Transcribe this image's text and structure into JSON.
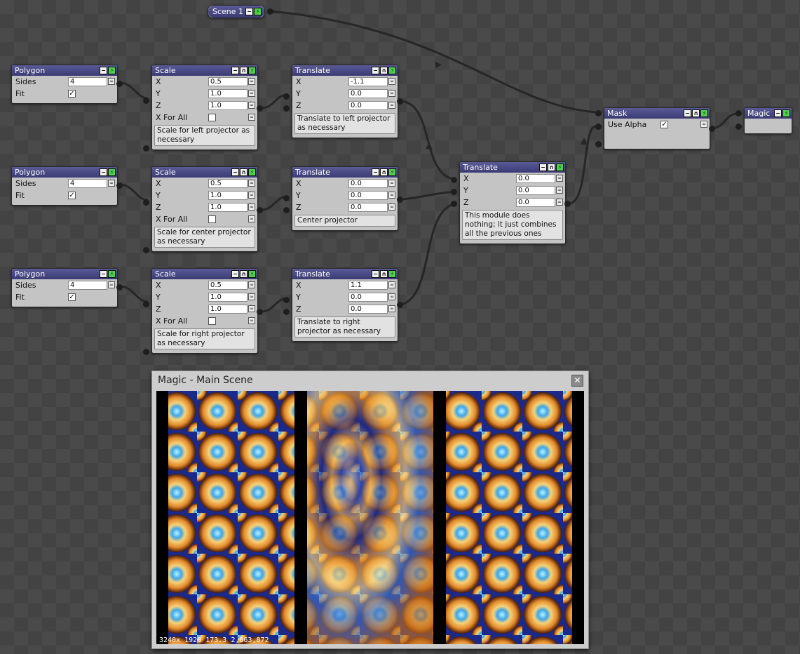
{
  "scene": {
    "title": "Scene 1"
  },
  "rows": [
    {
      "polygon": {
        "title": "Polygon",
        "sides_label": "Sides",
        "sides": "4",
        "fit_label": "Fit",
        "fit": "✓"
      },
      "scale": {
        "title": "Scale",
        "x_label": "X",
        "x": "0.5",
        "y_label": "Y",
        "y": "1.0",
        "z_label": "Z",
        "z": "1.0",
        "xforall_label": "X For All",
        "note": "Scale for left projector as necessary"
      },
      "translate": {
        "title": "Translate",
        "x_label": "X",
        "x": "-1.1",
        "y_label": "Y",
        "y": "0.0",
        "z_label": "Z",
        "z": "0.0",
        "note": "Translate to left projector as necessary"
      }
    },
    {
      "polygon": {
        "title": "Polygon",
        "sides_label": "Sides",
        "sides": "4",
        "fit_label": "Fit",
        "fit": "✓"
      },
      "scale": {
        "title": "Scale",
        "x_label": "X",
        "x": "0.5",
        "y_label": "Y",
        "y": "1.0",
        "z_label": "Z",
        "z": "1.0",
        "xforall_label": "X For All",
        "note": "Scale for center projector as necessary"
      },
      "translate": {
        "title": "Translate",
        "x_label": "X",
        "x": "0.0",
        "y_label": "Y",
        "y": "0.0",
        "z_label": "Z",
        "z": "0.0",
        "note": "Center projector"
      }
    },
    {
      "polygon": {
        "title": "Polygon",
        "sides_label": "Sides",
        "sides": "4",
        "fit_label": "Fit",
        "fit": "✓"
      },
      "scale": {
        "title": "Scale",
        "x_label": "X",
        "x": "0.5",
        "y_label": "Y",
        "y": "1.0",
        "z_label": "Z",
        "z": "1.0",
        "xforall_label": "X For All",
        "note": "Scale for right projector as necessary"
      },
      "translate": {
        "title": "Translate",
        "x_label": "X",
        "x": "1.1",
        "y_label": "Y",
        "y": "0.0",
        "z_label": "Z",
        "z": "0.0",
        "note": "Translate to right projector as necessary"
      }
    }
  ],
  "combine": {
    "title": "Translate",
    "x_label": "X",
    "x": "0.0",
    "y_label": "Y",
    "y": "0.0",
    "z_label": "Z",
    "z": "0.0",
    "note": "This module does nothing; it just combines all the previous ones"
  },
  "mask": {
    "title": "Mask",
    "use_alpha_label": "Use Alpha",
    "use_alpha": "✓"
  },
  "magic": {
    "title": "Magic"
  },
  "viewer": {
    "title": "Magic - Main Scene",
    "close": "✕",
    "status": "3240x 1920   173.3   2,863,872"
  },
  "icons": {
    "minimize": "minus-icon",
    "bypass": "bypass-icon",
    "power": "power-icon",
    "link": "link-icon",
    "spin": "spinner-arrows-icon"
  },
  "colors": {
    "header": "#3a3a74",
    "power": "#4fd04f",
    "node_body": "#c4c4c4",
    "wire": "#262626"
  }
}
